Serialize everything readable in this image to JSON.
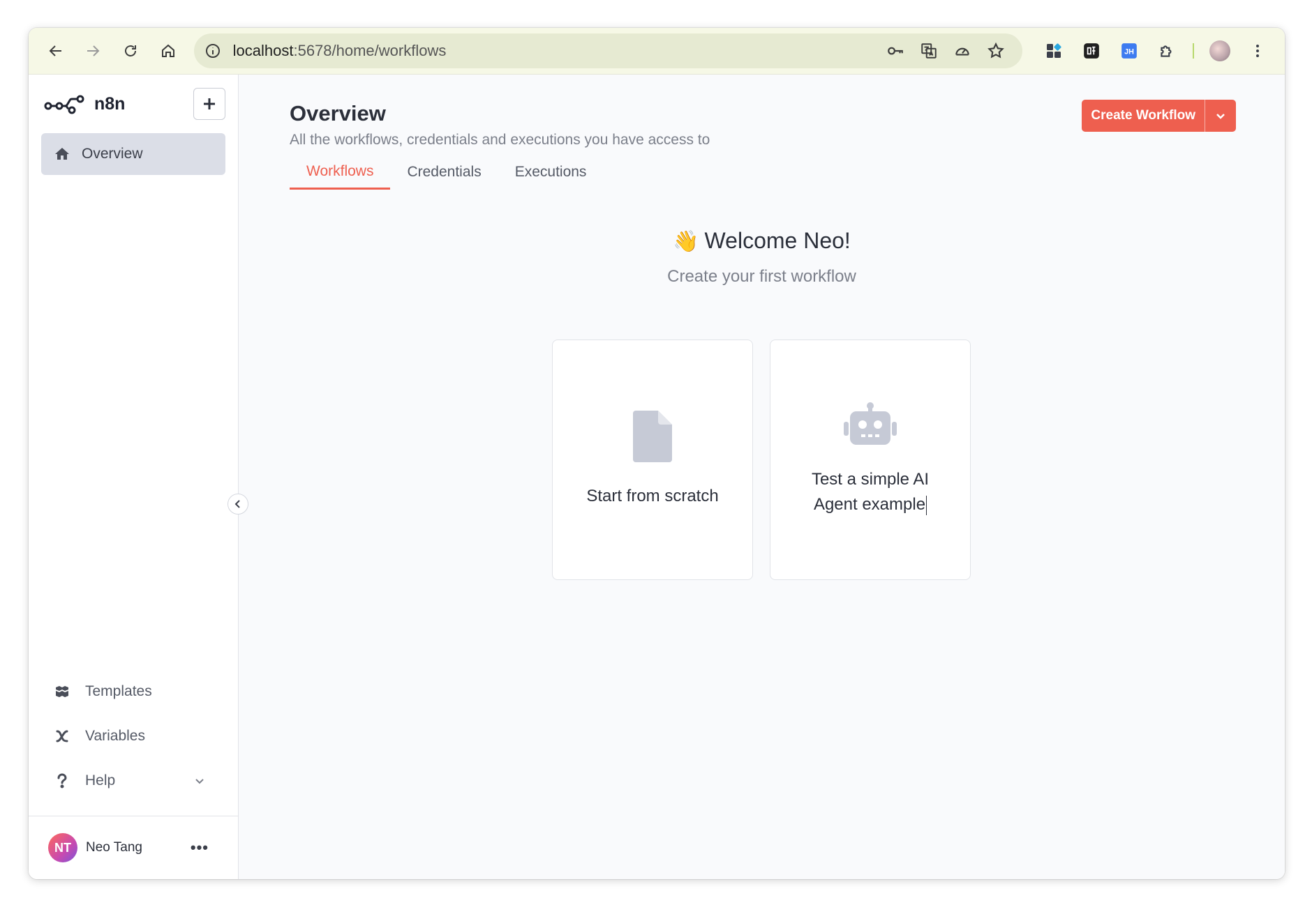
{
  "browser": {
    "url_host": "localhost",
    "url_path": ":5678/home/workflows"
  },
  "sidebar": {
    "logo_text": "n8n",
    "nav": [
      {
        "label": "Overview",
        "active": true
      }
    ],
    "bottom": [
      {
        "label": "Templates"
      },
      {
        "label": "Variables"
      },
      {
        "label": "Help"
      }
    ],
    "user": {
      "initials": "NT",
      "name": "Neo Tang",
      "more": "•••"
    }
  },
  "main": {
    "title": "Overview",
    "subtitle": "All the workflows, credentials and executions you have access to",
    "create_button": "Create Workflow",
    "tabs": [
      {
        "label": "Workflows",
        "active": true
      },
      {
        "label": "Credentials"
      },
      {
        "label": "Executions"
      }
    ],
    "welcome_emoji": "👋",
    "welcome": "Welcome Neo!",
    "welcome_sub": "Create your first workflow",
    "cards": [
      {
        "label": "Start from scratch",
        "icon": "file-icon"
      },
      {
        "label_line1": "Test a simple AI",
        "label_line2": "Agent example",
        "icon": "robot-icon"
      }
    ]
  },
  "colors": {
    "accent": "#ee5f4f",
    "toolbar_bg": "#f6f8e6",
    "omnibox_bg": "#e6ead2",
    "sidebar_active": "#dbdee7",
    "main_bg": "#f9fafc"
  }
}
